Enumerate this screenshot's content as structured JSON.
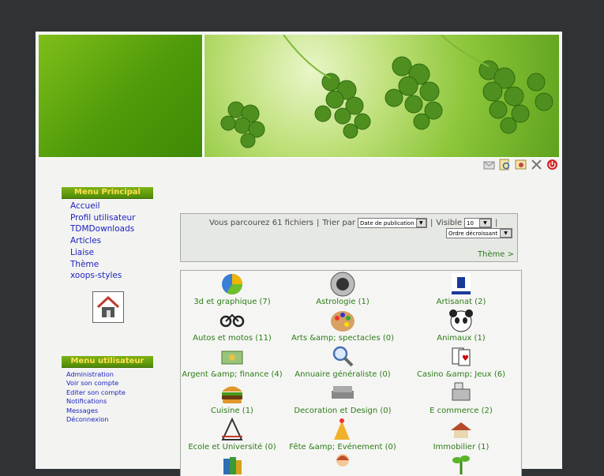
{
  "user_icons": [
    "inbox-icon",
    "search-icon",
    "image-icon",
    "tools-icon",
    "power-icon"
  ],
  "menu_principal": {
    "title": "Menu Principal",
    "items": [
      "Accueil",
      "Profil utilisateur",
      "TDMDownloads",
      "Articles",
      "Liaise",
      "Thème",
      "xoops-styles"
    ]
  },
  "menu_utilisateur": {
    "title": "Menu utilisateur",
    "items": [
      "Administration",
      "Voir son compte",
      "Editer son compte",
      "Notifications",
      "Messages",
      "Déconnexion"
    ]
  },
  "bar": {
    "browse_text": "Vous parcourez 61 fichiers",
    "sep1": "|",
    "sort_label": "Trier par",
    "sort_value": "Date de publication",
    "sep2": "|",
    "visible_label": "Visible",
    "visible_value": "10",
    "sep3": "|",
    "order_value": "Ordre décroissant",
    "theme_link": "Thème >"
  },
  "categories": [
    {
      "label": "3d et graphique (7)",
      "icon": "pie-chart-icon"
    },
    {
      "label": "Astrologie (1)",
      "icon": "zodiac-icon"
    },
    {
      "label": "Artisanat (2)",
      "icon": "artisanat-logo-icon"
    },
    {
      "label": "Autos et motos (11)",
      "icon": "motorbike-icon"
    },
    {
      "label": "Arts &amp; spectacles (0)",
      "icon": "palette-icon"
    },
    {
      "label": "Animaux (1)",
      "icon": "panda-icon"
    },
    {
      "label": "Argent &amp; finance (4)",
      "icon": "money-icon"
    },
    {
      "label": "Annuaire généraliste (0)",
      "icon": "magnifier-icon"
    },
    {
      "label": "Casino &amp; Jeux (6)",
      "icon": "cards-icon"
    },
    {
      "label": "Cuisine (1)",
      "icon": "burger-icon"
    },
    {
      "label": "Decoration et Design (0)",
      "icon": "sofa-icon"
    },
    {
      "label": "E commerce (2)",
      "icon": "cash-register-icon"
    },
    {
      "label": "Ecole et Université (0)",
      "icon": "geometry-icon"
    },
    {
      "label": "Fête &amp; Evénement (0)",
      "icon": "party-icon"
    },
    {
      "label": "Immobilier (1)",
      "icon": "house-icon"
    },
    {
      "label": "",
      "icon": "books-icon"
    },
    {
      "label": "",
      "icon": "child-icon"
    },
    {
      "label": "",
      "icon": "plant-icon"
    }
  ]
}
